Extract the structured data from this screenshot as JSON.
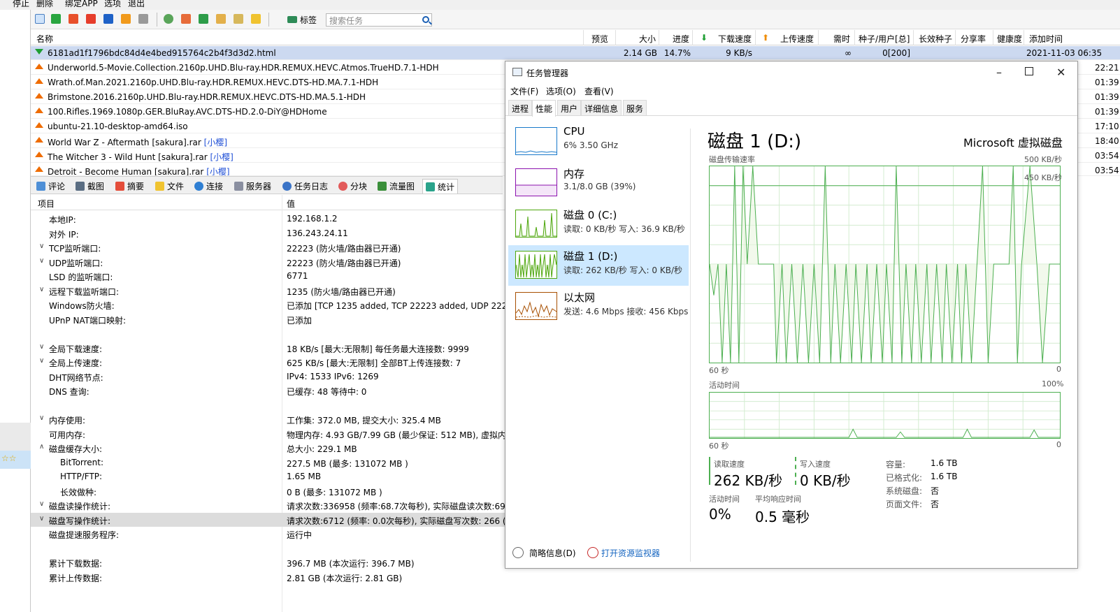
{
  "menubar": {
    "items": [
      "停止",
      "删除",
      "绑定APP",
      "选项",
      "退出"
    ]
  },
  "toolbar": {
    "tag_label": "标签",
    "search_placeholder": "搜索任务"
  },
  "list": {
    "columns": [
      "名称",
      "预览",
      "大小",
      "进度",
      "下载速度",
      "上传速度",
      "需时",
      "种子/用户[总]",
      "长效种子",
      "分享率",
      "健康度",
      "添加时间"
    ],
    "rows": [
      {
        "name": "6181ad1f1796bdc84d4e4bed915764c2b4f3d3d2.html",
        "tag": "",
        "size": "2.14 GB",
        "progress": "14.7%",
        "down": "9 KB/s",
        "eta": "∞",
        "seeds": "0[200]",
        "added": "2021-11-03 06:35",
        "dir": "down"
      },
      {
        "name": "Underworld.5-Movie.Collection.2160p.UHD.Blu-ray.HDR.REMUX.HEVC.Atmos.TrueHD.7.1-HDH",
        "tag": "",
        "added": "22:21",
        "dir": "up"
      },
      {
        "name": "Wrath.of.Man.2021.2160p.UHD.Blu-ray.HDR.REMUX.HEVC.DTS-HD.MA.7.1-HDH",
        "tag": "",
        "added": "01:39",
        "dir": "up"
      },
      {
        "name": "Brimstone.2016.2160p.UHD.Blu-ray.HDR.REMUX.HEVC.DTS-HD.MA.5.1-HDH",
        "tag": "",
        "added": "01:39",
        "dir": "up"
      },
      {
        "name": "100.Rifles.1969.1080p.GER.BluRay.AVC.DTS-HD.2.0-DiY@HDHome",
        "tag": "",
        "added": "01:39",
        "dir": "up"
      },
      {
        "name": "ubuntu-21.10-desktop-amd64.iso",
        "tag": "",
        "added": "17:10",
        "dir": "up"
      },
      {
        "name": "World War Z - Aftermath [sakura].rar",
        "tag": "[小樱]",
        "added": "18:40",
        "dir": "up"
      },
      {
        "name": "The Witcher 3 - Wild Hunt [sakura].rar",
        "tag": "[小樱]",
        "added": "03:54",
        "dir": "up"
      },
      {
        "name": "Detroit - Become Human [sakura].rar",
        "tag": "[小樱]",
        "added": "03:54",
        "dir": "up"
      }
    ]
  },
  "tabs": [
    "评论",
    "截图",
    "摘要",
    "文件",
    "连接",
    "服务器",
    "任务日志",
    "分块",
    "流量图",
    "统计"
  ],
  "stats": {
    "col_item": "项目",
    "col_value": "值",
    "rows": [
      {
        "k": "本地IP:",
        "v": "192.168.1.2",
        "chev": ""
      },
      {
        "k": "对外 IP:",
        "v": "136.243.24.11",
        "chev": ""
      },
      {
        "k": "TCP监听端口:",
        "v": "22223 (防火墙/路由器已开通)",
        "chev": "∨"
      },
      {
        "k": "UDP监听端口:",
        "v": "22223 (防火墙/路由器已开通)",
        "chev": "∨"
      },
      {
        "k": "LSD 的监听端口:",
        "v": "6771",
        "chev": ""
      },
      {
        "k": "远程下载监听端口:",
        "v": "1235 (防火墙/路由器已开通)",
        "chev": "∨"
      },
      {
        "k": "Windows防火墙:",
        "v": "已添加 [TCP 1235 added, TCP 22223 added, UDP 22223",
        "chev": ""
      },
      {
        "k": "UPnP NAT端口映射:",
        "v": "已添加",
        "chev": ""
      },
      {
        "k": "",
        "v": "",
        "chev": ""
      },
      {
        "k": "全局下载速度:",
        "v": "18 KB/s [最大:无限制]      每任务最大连接数: 9999",
        "chev": "∨"
      },
      {
        "k": "全局上传速度:",
        "v": "625 KB/s [最大:无限制]      全部BT上传连接数: 7",
        "chev": "∨"
      },
      {
        "k": "DHT网络节点:",
        "v": "IPv4: 1533  IPv6: 1269",
        "chev": ""
      },
      {
        "k": "DNS 查询:",
        "v": "已缓存:   48    等待中:   0",
        "chev": ""
      },
      {
        "k": "",
        "v": "",
        "chev": ""
      },
      {
        "k": "内存使用:",
        "v": "工作集: 372.0 MB, 提交大小: 325.4 MB",
        "chev": "∨"
      },
      {
        "k": "可用内存:",
        "v": "物理内存: 4.93 GB/7.99 GB (最少保证: 512 MB), 虚拟内存",
        "chev": ""
      },
      {
        "k": "磁盘缓存大小:",
        "v": "总大小:  229.1 MB",
        "chev": "∧"
      },
      {
        "k": "BitTorrent:",
        "v": "227.5 MB (最多: 131072 MB )",
        "chev": "",
        "indent": true
      },
      {
        "k": "HTTP/FTP:",
        "v": "1.65 MB",
        "chev": "",
        "indent": true
      },
      {
        "k": "长效做种:",
        "v": "0 B (最多: 131072 MB )",
        "chev": "",
        "indent": true
      },
      {
        "k": "磁盘读操作统计:",
        "v": "请求次数:336958 (频率:68.7次每秒), 实际磁盘读次数:697 (",
        "chev": "∨"
      },
      {
        "k": "磁盘写操作统计:",
        "v": "请求次数:6712 (频率: 0.0次每秒), 实际磁盘写次数:  266 (",
        "chev": "∨",
        "hl": true
      },
      {
        "k": "磁盘提速服务程序:",
        "v": "运行中",
        "chev": ""
      },
      {
        "k": "",
        "v": "",
        "chev": ""
      },
      {
        "k": "累计下载数据:",
        "v": "396.7 MB (本次运行: 396.7 MB)",
        "chev": ""
      },
      {
        "k": "累计上传数据:",
        "v": "2.81 GB (本次运行: 2.81 GB)",
        "chev": ""
      }
    ]
  },
  "taskmgr": {
    "title": "任务管理器",
    "menu": [
      "文件(F)",
      "选项(O)",
      "查看(V)"
    ],
    "tabs": [
      "进程",
      "性能",
      "用户",
      "详细信息",
      "服务"
    ],
    "perf_items": [
      {
        "name": "CPU",
        "sub": "6% 3.50 GHz",
        "color": "#1979ca"
      },
      {
        "name": "内存",
        "sub": "3.1/8.0 GB (39%)",
        "color": "#8b12ae"
      },
      {
        "name": "磁盘 0 (C:)",
        "sub": "读取: 0 KB/秒 写入: 36.9 KB/秒",
        "color": "#4da60c"
      },
      {
        "name": "磁盘 1 (D:)",
        "sub": "读取: 262 KB/秒 写入: 0 KB/秒",
        "color": "#4da60c"
      },
      {
        "name": "以太网",
        "sub": "发送: 4.6 Mbps 接收: 456 Kbps",
        "color": "#a74f01"
      }
    ],
    "disk_title": "磁盘 1 (D:)",
    "disk_model": "Microsoft 虚拟磁盘",
    "graph1_label": "磁盘传输速率",
    "graph1_max": "500 KB/秒",
    "graph1_ref": "450 KB/秒",
    "graph1_time": "60 秒",
    "graph1_min": "0",
    "graph2_label": "活动时间",
    "graph2_max": "100%",
    "graph2_time": "60 秒",
    "graph2_min": "0",
    "read_label": "读取速度",
    "read_value": "262 KB/秒",
    "write_label": "写入速度",
    "write_value": "0 KB/秒",
    "active_label": "活动时间",
    "active_value": "0%",
    "resp_label": "平均响应时间",
    "resp_value": "0.5 毫秒",
    "info": [
      {
        "k": "容量:",
        "v": "1.6 TB"
      },
      {
        "k": "已格式化:",
        "v": "1.6 TB"
      },
      {
        "k": "系统磁盘:",
        "v": "否"
      },
      {
        "k": "页面文件:",
        "v": "否"
      }
    ],
    "footer_brief": "简略信息(D)",
    "footer_resmon": "打开资源监视器"
  }
}
